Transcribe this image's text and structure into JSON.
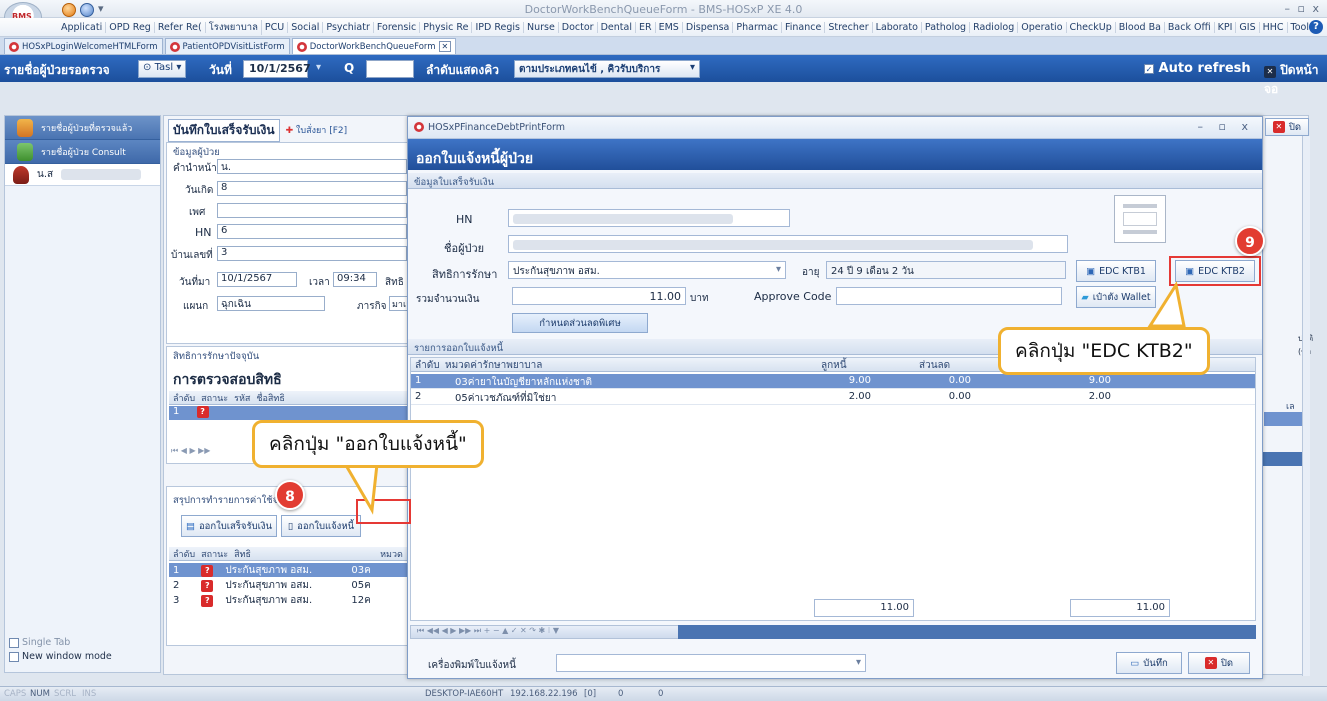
{
  "window": {
    "title": "DoctorWorkBenchQueueForm - BMS-HOSxP XE 4.0",
    "logo": "BMS",
    "controls": "–  ▫  x"
  },
  "menu": [
    "Applicati",
    "OPD Reg",
    "Refer Re(",
    "โรงพยาบาล",
    "PCU",
    "Social",
    "Psychiatr",
    "Forensic",
    "Physic Re",
    "IPD Regis",
    "Nurse",
    "Doctor",
    "Dental",
    "ER",
    "EMS",
    "Dispensa",
    "Pharmac",
    "Finance",
    "Strecher",
    "Laborato",
    "Patholog",
    "Radiolog",
    "Operatio",
    "CheckUp",
    "Blood Ba",
    "Back Offi",
    "KPI",
    "GIS",
    "HHC",
    "Tools"
  ],
  "tabs": [
    "HOSxPLoginWelcomeHTMLForm",
    "PatientOPDVisitListForm",
    "DoctorWorkBenchQueueForm"
  ],
  "toolbar": {
    "title": "รายชื่อผู้ป่วยรอตรวจ",
    "filter": "Tasl",
    "date_label": "วันที่",
    "date": "10/1/2567",
    "q": "Q",
    "order_label": "ลำดับแสดงคิว",
    "order_value": "ตามประเภทคนไข้ , คิวรับบริการ",
    "auto_refresh": "Auto refresh",
    "close_screen": "ปิดหน้าจอ"
  },
  "sidebar": {
    "items": [
      "รายชื่อผู้ป่วยที่ตรวจแล้ว",
      "รายชื่อผู้ป่วย Consult"
    ],
    "patient": "น.ส",
    "single_tab": "Single Tab",
    "new_window": "New window mode"
  },
  "main": {
    "tab_title": "บันทึกใบเสร็จรับเงิน",
    "tab_order": "ใบสั่งยา [F2]",
    "patient_group": "ข้อมูลผู้ป่วย",
    "prename_label": "คำนำหน้า",
    "prename": "น.",
    "dob_label": "วันเกิด",
    "dob": "8",
    "sex_label": "เพศ",
    "hn_label": "HN",
    "hn": "6",
    "address_label": "บ้านเลขที่",
    "address": "3",
    "visit_date_label": "วันที่มา",
    "visit_date": "10/1/2567",
    "time_label": "เวลา",
    "time": "09:34",
    "rights_short": "สิทธิ",
    "dept_label": "แผนก",
    "dept": "ฉุกเฉิน",
    "sub_label": "ภารกิจ",
    "sub": "มาเอ",
    "current_rights": "สิทธิการรักษาปัจจุบัน",
    "check_rights": "การตรวจสอบสิทธิ",
    "rights_headers": [
      "ลำดับ",
      "สถานะ",
      "รหัส",
      "ชื่อสิทธิ"
    ],
    "rights_row": [
      "1",
      "?"
    ],
    "summary_title": "สรุปการทำรายการค่าใช้จ่าย",
    "receipt_btn": "ออกใบเสร็จรับเงิน",
    "debt_btn": "ออกใบแจ้งหนี้",
    "right_extra": "ปกติ (ขา",
    "sum_headers": [
      "ลำดับ",
      "สถานะ",
      "สิทธิ",
      "หมวด"
    ],
    "sum_rows": [
      [
        "1",
        "?",
        "ประกันสุขภาพ อสม.",
        "03ค"
      ],
      [
        "2",
        "?",
        "ประกันสุขภาพ อสม.",
        "05ค"
      ],
      [
        "3",
        "?",
        "ประกันสุขภาพ อสม.",
        "12ค"
      ]
    ],
    "right_col": "เล"
  },
  "dialog": {
    "title": "HOSxPFinanceDebtPrintForm",
    "header": "ออกใบแจ้งหนี้ผู้ป่วย",
    "section1": "ข้อมูลใบเสร็จรับเงิน",
    "hn_label": "HN",
    "name_label": "ชื่อผู้ป่วย",
    "right_label": "สิทธิการรักษา",
    "right_value": "ประกันสุขภาพ อสม.",
    "age_label": "อายุ",
    "age_value": "24 ปี 9 เดือน 2 วัน",
    "total_label": "รวมจำนวนเงิน",
    "total_value": "11.00",
    "currency": "บาท",
    "approve_label": "Approve Code",
    "discount_btn": "กำหนดส่วนลดพิเศษ",
    "edc1": "EDC KTB1",
    "edc2": "EDC KTB2",
    "wallet": "เป๋าตัง Wallet",
    "section2": "รายการออกใบแจ้งหนี้",
    "grid_headers": [
      "ลำดับ",
      "หมวดค่ารักษาพยาบาล",
      "ลูกหนี้",
      "ส่วนลด"
    ],
    "grid_rows": [
      [
        "1",
        "03ค่ายาในบัญชียาหลักแห่งชาติ",
        "9.00",
        "0.00",
        "9.00"
      ],
      [
        "2",
        "05ค่าเวชภัณฑ์ที่มิใช่ยา",
        "2.00",
        "0.00",
        "2.00"
      ]
    ],
    "footer_total1": "11.00",
    "footer_total2": "11.00",
    "printer_label": "เครื่องพิมพ์ใบแจ้งหนี้",
    "save_btn": "บันทึก",
    "close_btn": "ปิด",
    "nav": "⏮ ◀◀ ◀ ▶ ▶▶ ⏭ + − ▲ ✓ ✕ ↷ ✱ ⁝ ▼"
  },
  "annotations": {
    "callout1": "คลิกปุ่ม \"ออกใบแจ้งหนี้\"",
    "callout2": "คลิกปุ่ม \"EDC KTB2\"",
    "step1": "8",
    "step2": "9"
  },
  "close_label": "ปิด",
  "status": {
    "caps": "CAPS",
    "num": "NUM",
    "scrl": "SCRL",
    "ins": "INS",
    "host": "DESKTOP-IAE60HT",
    "ip": "192.168.22.196",
    "f1": "[0]",
    "f2": "0",
    "f3": "0"
  },
  "colors": {
    "toolbar": "#2360ad",
    "dialog_header": "#2f62b2",
    "callout_border": "#f0b130",
    "badge": "#e23c31",
    "highlight": "#e53935"
  }
}
